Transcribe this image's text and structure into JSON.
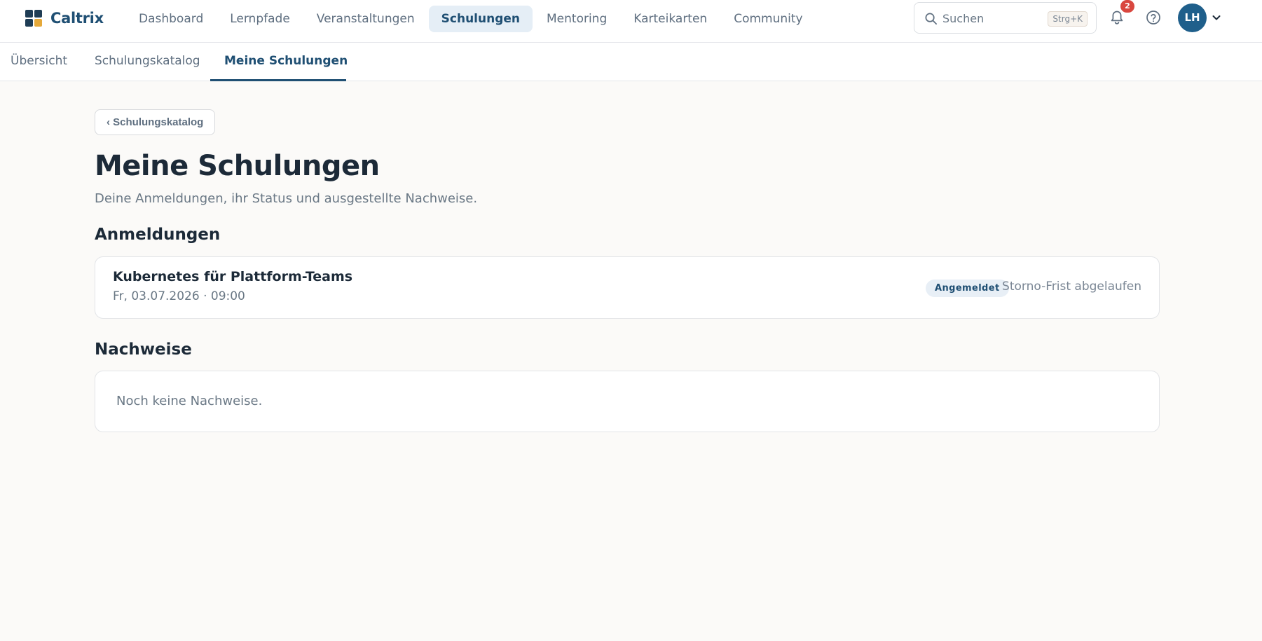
{
  "brand": {
    "name": "Caltrix",
    "colors": {
      "tile1": "#1f3d55",
      "tile2": "#1f3d55",
      "tile3": "#1f3d55",
      "tile4": "#e5a93a"
    }
  },
  "mainnav": {
    "items": [
      {
        "label": "Dashboard"
      },
      {
        "label": "Lernpfade"
      },
      {
        "label": "Veranstaltungen"
      },
      {
        "label": "Schulungen",
        "active": true
      },
      {
        "label": "Mentoring"
      },
      {
        "label": "Karteikarten"
      },
      {
        "label": "Community"
      }
    ]
  },
  "search": {
    "placeholder": "Suchen",
    "shortcut": "Strg+K",
    "icon": "search-icon"
  },
  "notifications": {
    "count": "2",
    "icon": "bell-icon"
  },
  "help": {
    "icon": "help-circle-icon"
  },
  "user": {
    "initials": "LH",
    "caret_icon": "chevron-down-icon"
  },
  "subtabs": {
    "items": [
      {
        "label": "Übersicht"
      },
      {
        "label": "Schulungskatalog"
      },
      {
        "label": "Meine Schulungen",
        "active": true
      }
    ]
  },
  "page": {
    "back_label": "‹ Schulungskatalog",
    "title": "Meine Schulungen",
    "subtitle": "Deine Anmeldungen, ihr Status und ausgestellte Nachweise."
  },
  "registrations": {
    "heading": "Anmeldungen",
    "items": [
      {
        "title": "Kubernetes für Plattform-Teams",
        "date": "Fr, 03.07.2026 · 09:00",
        "status": "Angemeldet",
        "note": "Storno-Frist abgelaufen"
      }
    ]
  },
  "proofs": {
    "heading": "Nachweise",
    "empty_text": "Noch keine Nachweise."
  },
  "colors": {
    "accent": "#1f4f73",
    "avatar_bg": "#1f5f8b",
    "badge_red": "#d9473f",
    "page_bg": "#fbfaf8"
  }
}
